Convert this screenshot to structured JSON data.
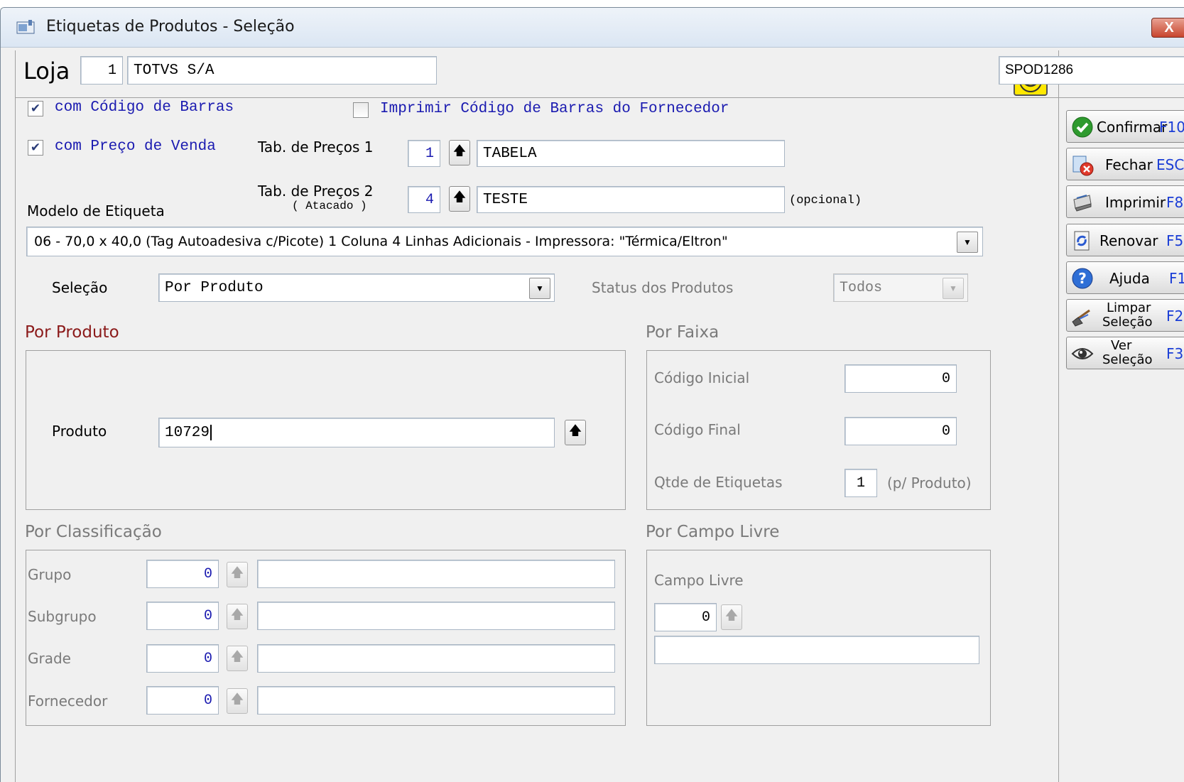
{
  "window": {
    "title": "Etiquetas de Produtos - Seleção",
    "close_label": "X"
  },
  "loja": {
    "label": "Loja",
    "code": "1",
    "name": "TOTVS S/A"
  },
  "machine": "SPOD1286",
  "options": {
    "barcode_label": "com Código de Barras",
    "barcode_checked": true,
    "supplier_barcode_label": "Imprimir Código de Barras do Fornecedor",
    "supplier_barcode_checked": false,
    "price_label": "com Preço de Venda",
    "price_checked": true
  },
  "price_table_1": {
    "label": "Tab. de Preços 1",
    "code": "1",
    "name": "TABELA"
  },
  "price_table_2": {
    "label": "Tab. de Preços 2",
    "sublabel": "( Atacado )",
    "code": "4",
    "name": "TESTE",
    "hint": "(opcional)"
  },
  "model": {
    "label": "Modelo de Etiqueta",
    "value": "06 - 70,0 x 40,0 (Tag Autoadesiva c/Picote) 1 Coluna 4 Linhas Adicionais - Impressora: \"Térmica/Eltron\""
  },
  "selection": {
    "label": "Seleção",
    "value": "Por Produto",
    "status_label": "Status dos Produtos",
    "status_value": "Todos"
  },
  "por_produto": {
    "title": "Por Produto",
    "product_label": "Produto",
    "product_value": "10729"
  },
  "por_faixa": {
    "title": "Por Faixa",
    "initial_label": "Código Inicial",
    "initial_value": "0",
    "final_label": "Código Final",
    "final_value": "0",
    "qty_label": "Qtde de Etiquetas",
    "qty_value": "1",
    "qty_hint": "(p/ Produto)"
  },
  "por_classificacao": {
    "title": "Por Classificação",
    "rows": [
      {
        "label": "Grupo",
        "value": "0",
        "desc": ""
      },
      {
        "label": "Subgrupo",
        "value": "0",
        "desc": ""
      },
      {
        "label": "Grade",
        "value": "0",
        "desc": ""
      },
      {
        "label": "Fornecedor",
        "value": "0",
        "desc": ""
      }
    ]
  },
  "por_campo_livre": {
    "title": "Por Campo Livre",
    "label": "Campo Livre",
    "value": "0",
    "desc": ""
  },
  "actions": {
    "confirm": {
      "label": "Confirmar",
      "key": "F10"
    },
    "close": {
      "label": "Fechar",
      "key": "ESC"
    },
    "print": {
      "label": "Imprimir",
      "key": "F8"
    },
    "refresh": {
      "label": "Renovar",
      "key": "F5"
    },
    "help": {
      "label": "Ajuda",
      "key": "F1"
    },
    "clear": {
      "label_1": "Limpar",
      "label_2": "Seleção",
      "key": "F2"
    },
    "view": {
      "label_1": "Ver",
      "label_2": "Seleção",
      "key": "F3"
    }
  },
  "arrow_glyph": "🡅"
}
